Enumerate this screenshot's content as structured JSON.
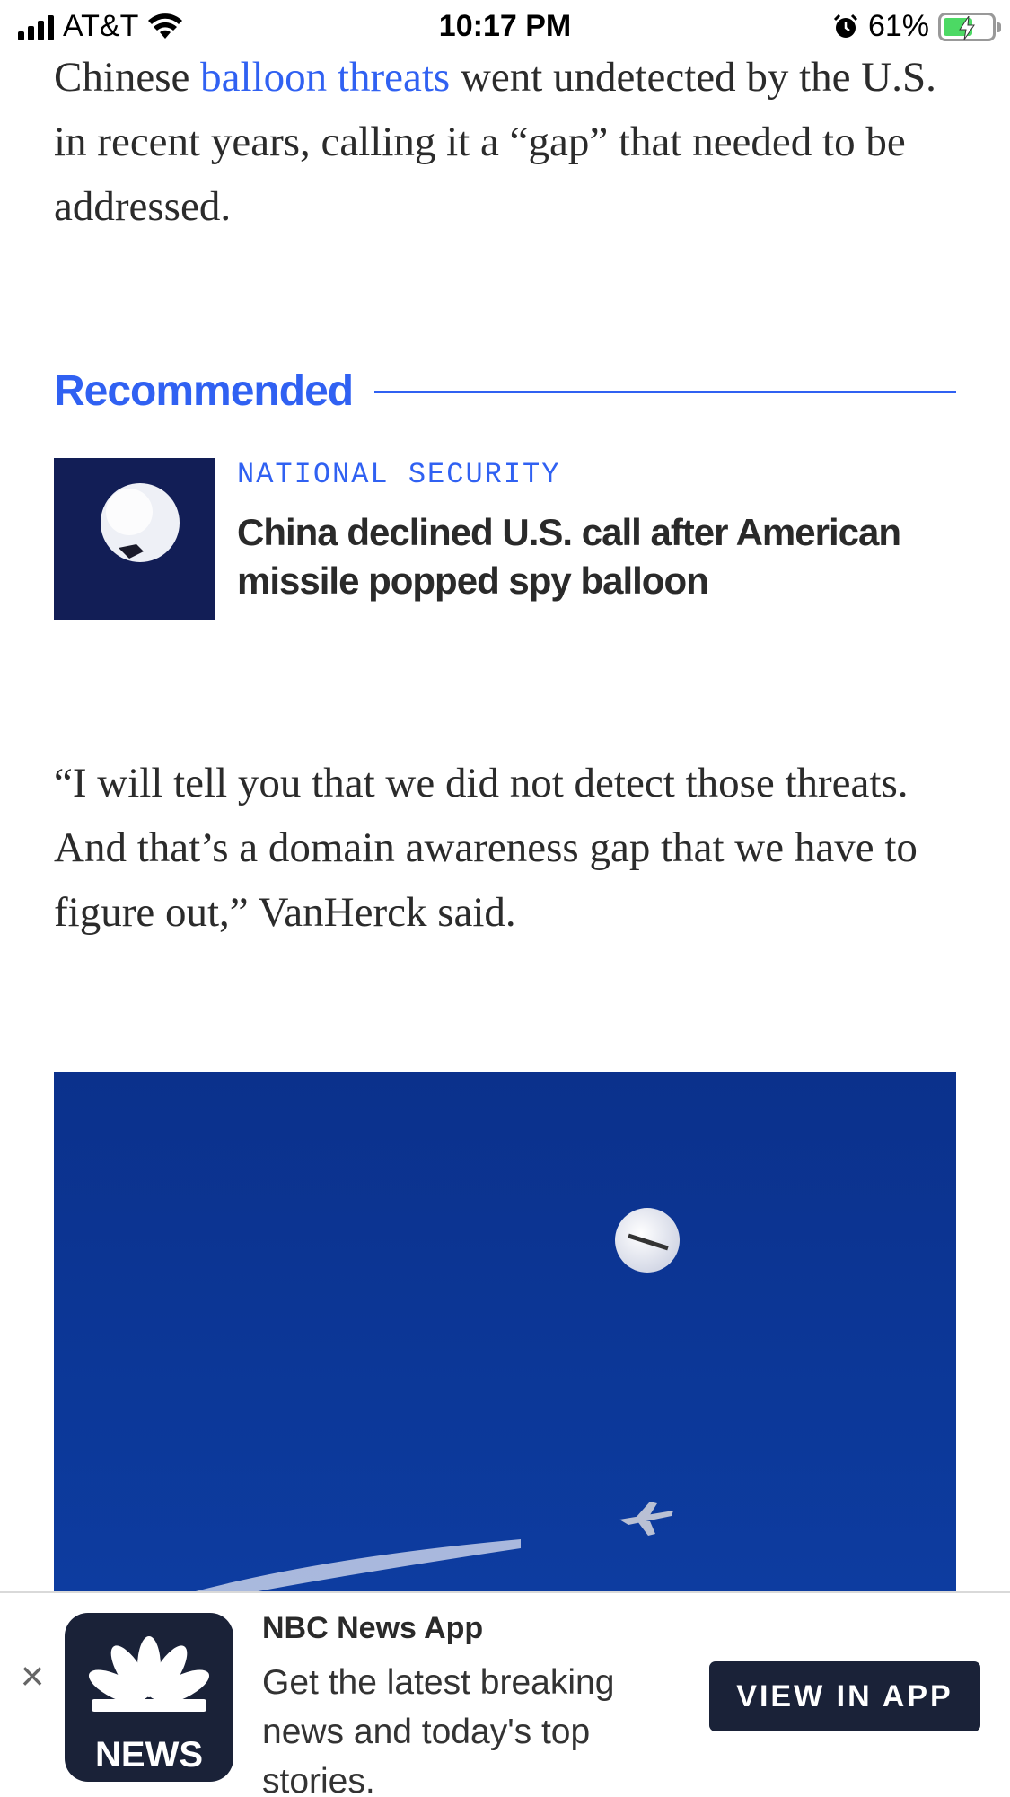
{
  "status_bar": {
    "carrier": "AT&T",
    "time": "10:17 PM",
    "battery_percent": "61%",
    "battery_level": 0.61,
    "icons": [
      "signal-icon",
      "wifi-icon",
      "alarm-icon",
      "battery-charging-icon"
    ]
  },
  "article": {
    "para1_before_link": "Chinese ",
    "para1_link": "balloon threats",
    "para1_after_link": " went undetected by the U.S. in recent years, calling it a “gap” that needed to be addressed.",
    "para2": "“I will tell you that we did not detect those threats. And that’s a domain awareness gap that we have to figure out,” VanHerck said."
  },
  "recommended": {
    "heading": "Recommended",
    "kicker": "NATIONAL SECURITY",
    "title": "China declined U.S. call after American missile popped spy balloon"
  },
  "app_banner": {
    "icon_word": "NEWS",
    "name": "NBC News App",
    "description": "Get the latest breaking news and today's top stories.",
    "button": "VIEW IN APP"
  },
  "colors": {
    "link_blue": "#3061f2",
    "banner_dark": "#1a2238",
    "sky_blue": "#0a3591"
  }
}
